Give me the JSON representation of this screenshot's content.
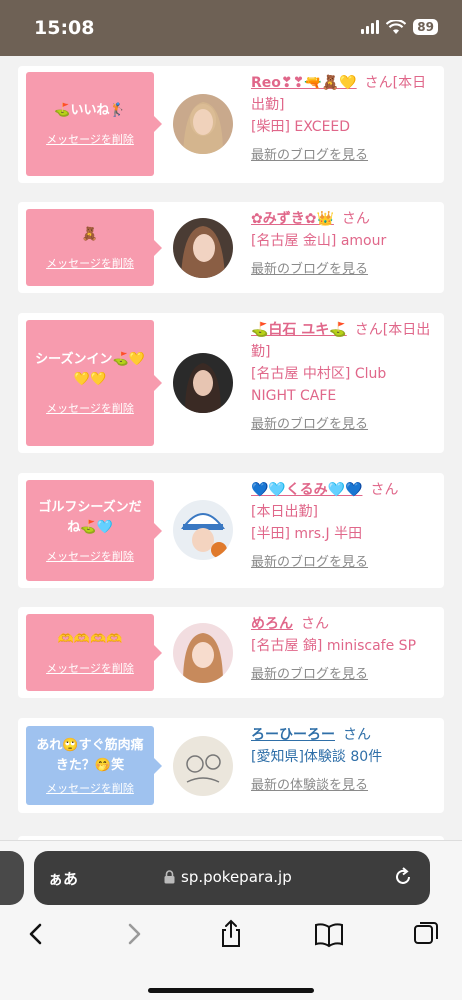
{
  "status": {
    "time": "15:08",
    "battery": "89"
  },
  "posts": [
    {
      "message": "⛳いいね🏌",
      "delete": "メッセージを削除",
      "name": "Reo❣❣🔫🧸💛",
      "san": "さん",
      "status_text": "[本日出勤]",
      "area": "[柴田] EXCEED",
      "link": "最新のブログを見る",
      "avatar": "woman-blonde",
      "type": "pink"
    },
    {
      "message": "🧸",
      "delete": "メッセージを削除",
      "name": "✿みずき✿👑",
      "san": "さん",
      "status_text": "",
      "area": "[名古屋 金山] amour",
      "link": "最新のブログを見る",
      "avatar": "woman-brown",
      "type": "pink"
    },
    {
      "message": "シーズンイン⛳💛💛💛",
      "delete": "メッセージを削除",
      "name": "⛳白石 ユキ⛳",
      "san": "さん",
      "status_text": "[本日出勤]",
      "area": "[名古屋 中村区] Club NIGHT CAFE",
      "link": "最新のブログを見る",
      "avatar": "woman-dark",
      "type": "pink"
    },
    {
      "message": "ゴルフシーズンだね⛳🩵",
      "delete": "メッセージを削除",
      "name": "💙🩵くるみ🩵💙",
      "san": "さん",
      "status_text": "[本日出勤]",
      "area": "[半田] mrs.J 半田",
      "link": "最新のブログを見る",
      "avatar": "woman-hat",
      "type": "pink"
    },
    {
      "message": "🫶🫶🫶🫶",
      "delete": "メッセージを削除",
      "name": "めろん",
      "san": "さん",
      "status_text": "",
      "area": "[名古屋 錦] miniscafe SP",
      "link": "最新のブログを見る",
      "avatar": "woman-pink",
      "type": "pink"
    },
    {
      "message": "あれ🙄すぐ筋肉痛きた？🤭笑",
      "delete": "メッセージを削除",
      "name": "ろーひーろー",
      "san": "さん",
      "status_text": "",
      "area": "[愛知県]体験談 80件",
      "link": "最新の体験談を見る",
      "avatar": "sketch",
      "type": "blue"
    }
  ],
  "browser": {
    "aa": "ぁあ",
    "url": "sp.pokepara.jp"
  },
  "icons": [
    "signal-icon",
    "wifi-icon",
    "battery-icon",
    "lock-icon",
    "reload-icon",
    "back-icon",
    "forward-icon",
    "share-icon",
    "bookmarks-icon",
    "tabs-icon"
  ],
  "colors": {
    "pink_bubble": "#f79bae",
    "blue_bubble": "#9fc2ef",
    "name_pink": "#e0678a",
    "name_blue": "#2f6fa8"
  }
}
